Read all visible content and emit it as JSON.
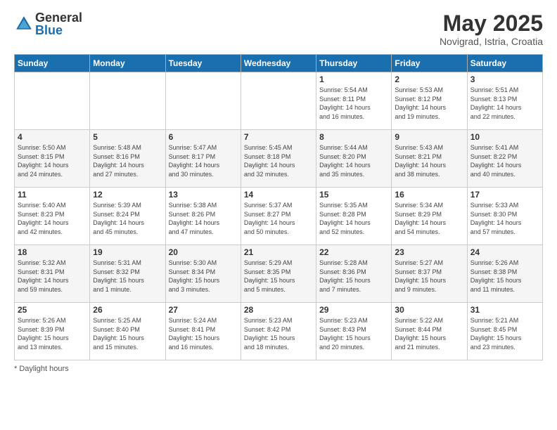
{
  "header": {
    "logo_general": "General",
    "logo_blue": "Blue",
    "month": "May 2025",
    "location": "Novigrad, Istria, Croatia"
  },
  "weekdays": [
    "Sunday",
    "Monday",
    "Tuesday",
    "Wednesday",
    "Thursday",
    "Friday",
    "Saturday"
  ],
  "footer": {
    "note": "Daylight hours"
  },
  "rows": [
    {
      "cells": [
        {
          "day": "",
          "info": ""
        },
        {
          "day": "",
          "info": ""
        },
        {
          "day": "",
          "info": ""
        },
        {
          "day": "",
          "info": ""
        },
        {
          "day": "1",
          "info": "Sunrise: 5:54 AM\nSunset: 8:11 PM\nDaylight: 14 hours\nand 16 minutes."
        },
        {
          "day": "2",
          "info": "Sunrise: 5:53 AM\nSunset: 8:12 PM\nDaylight: 14 hours\nand 19 minutes."
        },
        {
          "day": "3",
          "info": "Sunrise: 5:51 AM\nSunset: 8:13 PM\nDaylight: 14 hours\nand 22 minutes."
        }
      ]
    },
    {
      "cells": [
        {
          "day": "4",
          "info": "Sunrise: 5:50 AM\nSunset: 8:15 PM\nDaylight: 14 hours\nand 24 minutes."
        },
        {
          "day": "5",
          "info": "Sunrise: 5:48 AM\nSunset: 8:16 PM\nDaylight: 14 hours\nand 27 minutes."
        },
        {
          "day": "6",
          "info": "Sunrise: 5:47 AM\nSunset: 8:17 PM\nDaylight: 14 hours\nand 30 minutes."
        },
        {
          "day": "7",
          "info": "Sunrise: 5:45 AM\nSunset: 8:18 PM\nDaylight: 14 hours\nand 32 minutes."
        },
        {
          "day": "8",
          "info": "Sunrise: 5:44 AM\nSunset: 8:20 PM\nDaylight: 14 hours\nand 35 minutes."
        },
        {
          "day": "9",
          "info": "Sunrise: 5:43 AM\nSunset: 8:21 PM\nDaylight: 14 hours\nand 38 minutes."
        },
        {
          "day": "10",
          "info": "Sunrise: 5:41 AM\nSunset: 8:22 PM\nDaylight: 14 hours\nand 40 minutes."
        }
      ]
    },
    {
      "cells": [
        {
          "day": "11",
          "info": "Sunrise: 5:40 AM\nSunset: 8:23 PM\nDaylight: 14 hours\nand 42 minutes."
        },
        {
          "day": "12",
          "info": "Sunrise: 5:39 AM\nSunset: 8:24 PM\nDaylight: 14 hours\nand 45 minutes."
        },
        {
          "day": "13",
          "info": "Sunrise: 5:38 AM\nSunset: 8:26 PM\nDaylight: 14 hours\nand 47 minutes."
        },
        {
          "day": "14",
          "info": "Sunrise: 5:37 AM\nSunset: 8:27 PM\nDaylight: 14 hours\nand 50 minutes."
        },
        {
          "day": "15",
          "info": "Sunrise: 5:35 AM\nSunset: 8:28 PM\nDaylight: 14 hours\nand 52 minutes."
        },
        {
          "day": "16",
          "info": "Sunrise: 5:34 AM\nSunset: 8:29 PM\nDaylight: 14 hours\nand 54 minutes."
        },
        {
          "day": "17",
          "info": "Sunrise: 5:33 AM\nSunset: 8:30 PM\nDaylight: 14 hours\nand 57 minutes."
        }
      ]
    },
    {
      "cells": [
        {
          "day": "18",
          "info": "Sunrise: 5:32 AM\nSunset: 8:31 PM\nDaylight: 14 hours\nand 59 minutes."
        },
        {
          "day": "19",
          "info": "Sunrise: 5:31 AM\nSunset: 8:32 PM\nDaylight: 15 hours\nand 1 minute."
        },
        {
          "day": "20",
          "info": "Sunrise: 5:30 AM\nSunset: 8:34 PM\nDaylight: 15 hours\nand 3 minutes."
        },
        {
          "day": "21",
          "info": "Sunrise: 5:29 AM\nSunset: 8:35 PM\nDaylight: 15 hours\nand 5 minutes."
        },
        {
          "day": "22",
          "info": "Sunrise: 5:28 AM\nSunset: 8:36 PM\nDaylight: 15 hours\nand 7 minutes."
        },
        {
          "day": "23",
          "info": "Sunrise: 5:27 AM\nSunset: 8:37 PM\nDaylight: 15 hours\nand 9 minutes."
        },
        {
          "day": "24",
          "info": "Sunrise: 5:26 AM\nSunset: 8:38 PM\nDaylight: 15 hours\nand 11 minutes."
        }
      ]
    },
    {
      "cells": [
        {
          "day": "25",
          "info": "Sunrise: 5:26 AM\nSunset: 8:39 PM\nDaylight: 15 hours\nand 13 minutes."
        },
        {
          "day": "26",
          "info": "Sunrise: 5:25 AM\nSunset: 8:40 PM\nDaylight: 15 hours\nand 15 minutes."
        },
        {
          "day": "27",
          "info": "Sunrise: 5:24 AM\nSunset: 8:41 PM\nDaylight: 15 hours\nand 16 minutes."
        },
        {
          "day": "28",
          "info": "Sunrise: 5:23 AM\nSunset: 8:42 PM\nDaylight: 15 hours\nand 18 minutes."
        },
        {
          "day": "29",
          "info": "Sunrise: 5:23 AM\nSunset: 8:43 PM\nDaylight: 15 hours\nand 20 minutes."
        },
        {
          "day": "30",
          "info": "Sunrise: 5:22 AM\nSunset: 8:44 PM\nDaylight: 15 hours\nand 21 minutes."
        },
        {
          "day": "31",
          "info": "Sunrise: 5:21 AM\nSunset: 8:45 PM\nDaylight: 15 hours\nand 23 minutes."
        }
      ]
    }
  ]
}
